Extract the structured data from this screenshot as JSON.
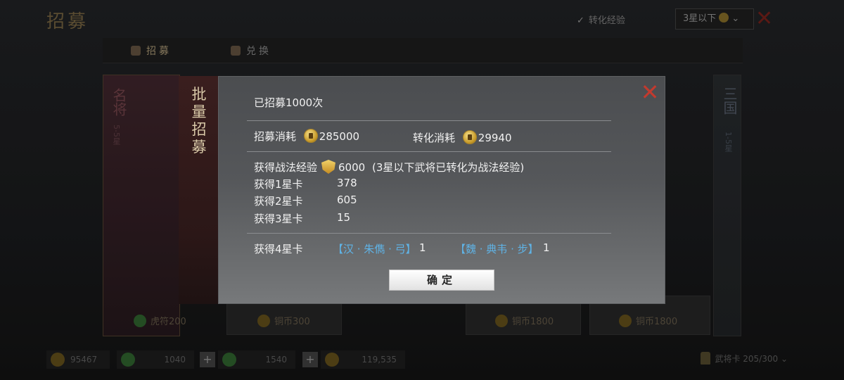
{
  "background": {
    "title": "招募",
    "convert_exp_checkbox": "转化经验",
    "star_filter": "3星以下",
    "tabs": [
      "招募",
      "兑换"
    ],
    "left_card": {
      "name": "名将",
      "sub": "5-5星"
    },
    "right_card": {
      "name": "三国",
      "sub": "1-5星"
    },
    "costs": [
      "虎符200",
      "铜币300",
      "铜币1800",
      "铜币1800"
    ],
    "resources": [
      "95467",
      "1040",
      "1540",
      "119,535"
    ],
    "general_capacity": "武将卡 205/300"
  },
  "modal": {
    "banner_title": "批量招募",
    "header": "已招募1000次",
    "recruit_cost_label": "招募消耗",
    "recruit_cost_value": "285000",
    "convert_cost_label": "转化消耗",
    "convert_cost_value": "29940",
    "exp_label": "获得战法经验",
    "exp_value": "6000",
    "exp_note": "(3星以下武将已转化为战法经验)",
    "star1_label": "获得1星卡",
    "star1_value": "378",
    "star2_label": "获得2星卡",
    "star2_value": "605",
    "star3_label": "获得3星卡",
    "star3_value": "15",
    "star4_label": "获得4星卡",
    "star4_cards": [
      {
        "name": "【汉 · 朱儁 · 弓】",
        "count": "1"
      },
      {
        "name": "【魏 · 典韦 · 步】",
        "count": "1"
      }
    ],
    "confirm_label": "确定"
  },
  "colors": {
    "accent_red": "#c23a2e",
    "card_link_blue": "#5fb3e6",
    "coin_gold": "#d4a736"
  },
  "icons": {
    "close": "close-x-icon",
    "coin": "copper-coin-icon",
    "exp": "exp-medal-icon"
  }
}
